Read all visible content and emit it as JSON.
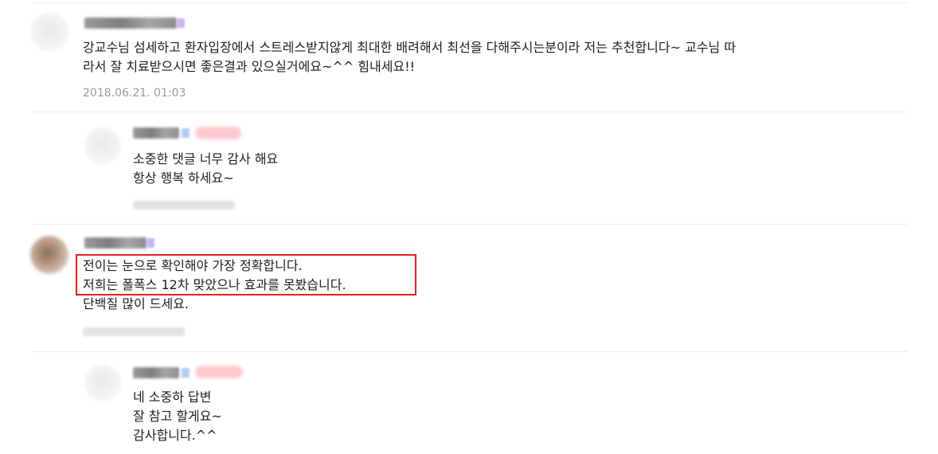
{
  "comments": [
    {
      "lines": [
        "강교수님 섬세하고 환자입장에서 스트레스받지않게 최대한 배려해서 최선을 다해주시는분이라 저는 추천합니다~ 교수님 따",
        "라서 잘 치료받으시면 좋은결과 있으실거에요~^^ 힘내세요!!"
      ],
      "date": "2018.06.21. 01:03"
    },
    {
      "lines": [
        "소중한 댓글 너무 감사 해요",
        "항상 행복 하세요~"
      ]
    },
    {
      "lines": [
        "전이는 눈으로 확인해야 가장 정확합니다.",
        "저희는 폴폭스 12차 맞았으나 효과를 못봤습니다.",
        "단백질 많이 드세요."
      ]
    },
    {
      "lines": [
        "네 소중하 답변",
        "잘 참고 할게요~",
        "감사합니다.^^"
      ]
    }
  ],
  "highlight_color": "#e31e24"
}
